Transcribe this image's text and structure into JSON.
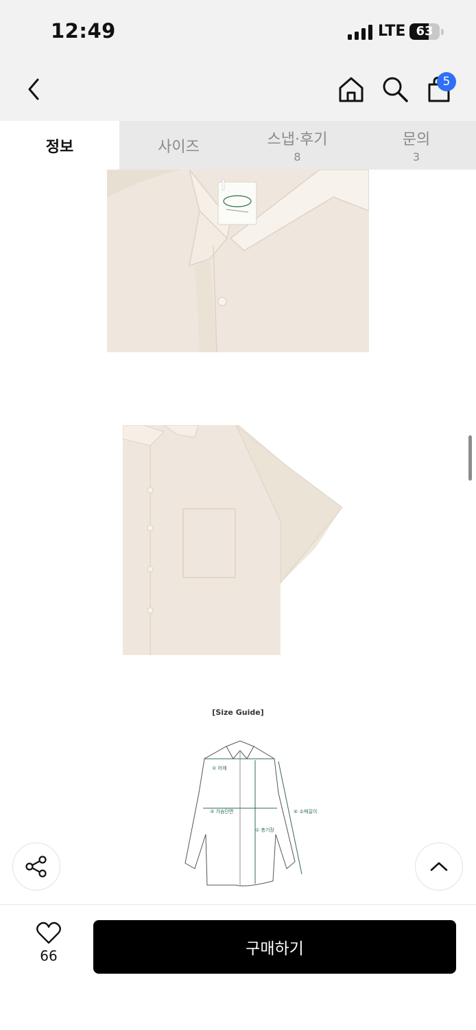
{
  "status_bar": {
    "time": "12:49",
    "network": "LTE",
    "battery": "63",
    "battery_level": 0.63
  },
  "nav": {
    "cart_badge": "5",
    "icons": [
      "back-arrow-icon",
      "home-icon",
      "search-icon",
      "shopping-bag-icon"
    ]
  },
  "tabs": [
    {
      "label": "정보",
      "count": ""
    },
    {
      "label": "사이즈",
      "count": ""
    },
    {
      "label": "스냅·후기",
      "count": "8"
    },
    {
      "label": "문의",
      "count": "3"
    }
  ],
  "size_guide": {
    "title": "[Size Guide]",
    "labels": {
      "shoulder": "② 어깨",
      "chest": "③ 가슴단면",
      "length": "① 총기장",
      "sleeve": "④ 소매길이"
    }
  },
  "floating": {
    "share_icon": "share-icon",
    "top_icon": "chevron-up-icon"
  },
  "bottom_bar": {
    "like_count": "66",
    "buy_label": "구매하기"
  },
  "colors": {
    "shirt": "#efe7dd",
    "accent_badge": "#2f6ff5",
    "buy_button": "#000000",
    "chrome_bg": "#f2f2f2",
    "size_line": "#2d6b52"
  }
}
